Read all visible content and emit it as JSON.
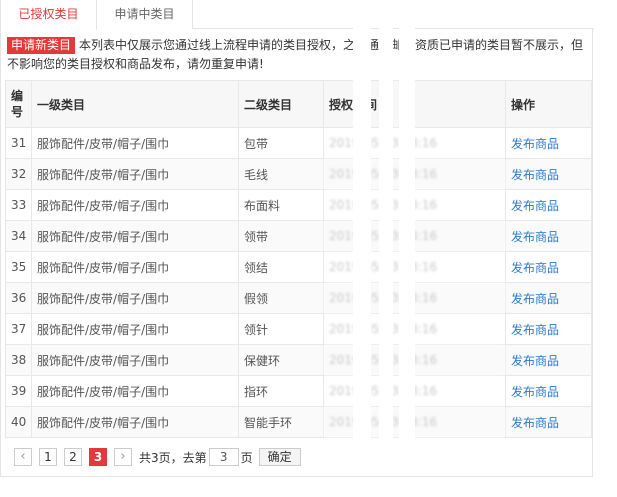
{
  "tabs": [
    {
      "label": "已授权类目",
      "active": true
    },
    {
      "label": "申请中类目",
      "active": false
    }
  ],
  "notice": {
    "button_label": "申请新类目",
    "text": "本列表中仅展示您通过线上流程申请的类目授权，之前通过邮寄资质已申请的类目暂不展示，但不影响您的类目授权和商品发布，请勿重复申请!"
  },
  "table": {
    "headers": [
      "编号",
      "一级类目",
      "二级类目",
      "授权时间",
      "操作"
    ],
    "rows": [
      {
        "id": "31",
        "cat1": "服饰配件/皮带/帽子/围巾",
        "cat2": "包带",
        "time": "2019-05-13 18:16",
        "action": "发布商品"
      },
      {
        "id": "32",
        "cat1": "服饰配件/皮带/帽子/围巾",
        "cat2": "毛线",
        "time": "2019-05-13 18:16",
        "action": "发布商品"
      },
      {
        "id": "33",
        "cat1": "服饰配件/皮带/帽子/围巾",
        "cat2": "布面料",
        "time": "2019-05-13 18:16",
        "action": "发布商品"
      },
      {
        "id": "34",
        "cat1": "服饰配件/皮带/帽子/围巾",
        "cat2": "领带",
        "time": "2019-05-13 18:16",
        "action": "发布商品"
      },
      {
        "id": "35",
        "cat1": "服饰配件/皮带/帽子/围巾",
        "cat2": "领结",
        "time": "2019-05-13 18:16",
        "action": "发布商品"
      },
      {
        "id": "36",
        "cat1": "服饰配件/皮带/帽子/围巾",
        "cat2": "假领",
        "time": "2019-05-13 18:16",
        "action": "发布商品"
      },
      {
        "id": "37",
        "cat1": "服饰配件/皮带/帽子/围巾",
        "cat2": "领针",
        "time": "2019-05-13 18:16",
        "action": "发布商品"
      },
      {
        "id": "38",
        "cat1": "服饰配件/皮带/帽子/围巾",
        "cat2": "保健环",
        "time": "2019-05-13 18:16",
        "action": "发布商品"
      },
      {
        "id": "39",
        "cat1": "服饰配件/皮带/帽子/围巾",
        "cat2": "指环",
        "time": "2019-05-13 18:16",
        "action": "发布商品"
      },
      {
        "id": "40",
        "cat1": "服饰配件/皮带/帽子/围巾",
        "cat2": "智能手环",
        "time": "2019-05-13 18:16",
        "action": "发布商品"
      }
    ]
  },
  "pager": {
    "prev": "‹",
    "pages": [
      "1",
      "2",
      "3"
    ],
    "current": "3",
    "next": "›",
    "total_text": "共3页，去第",
    "input_value": "3",
    "suffix": "页",
    "confirm_label": "确定"
  },
  "colors": {
    "accent": "#e4393c",
    "link": "#2a7bd1"
  }
}
